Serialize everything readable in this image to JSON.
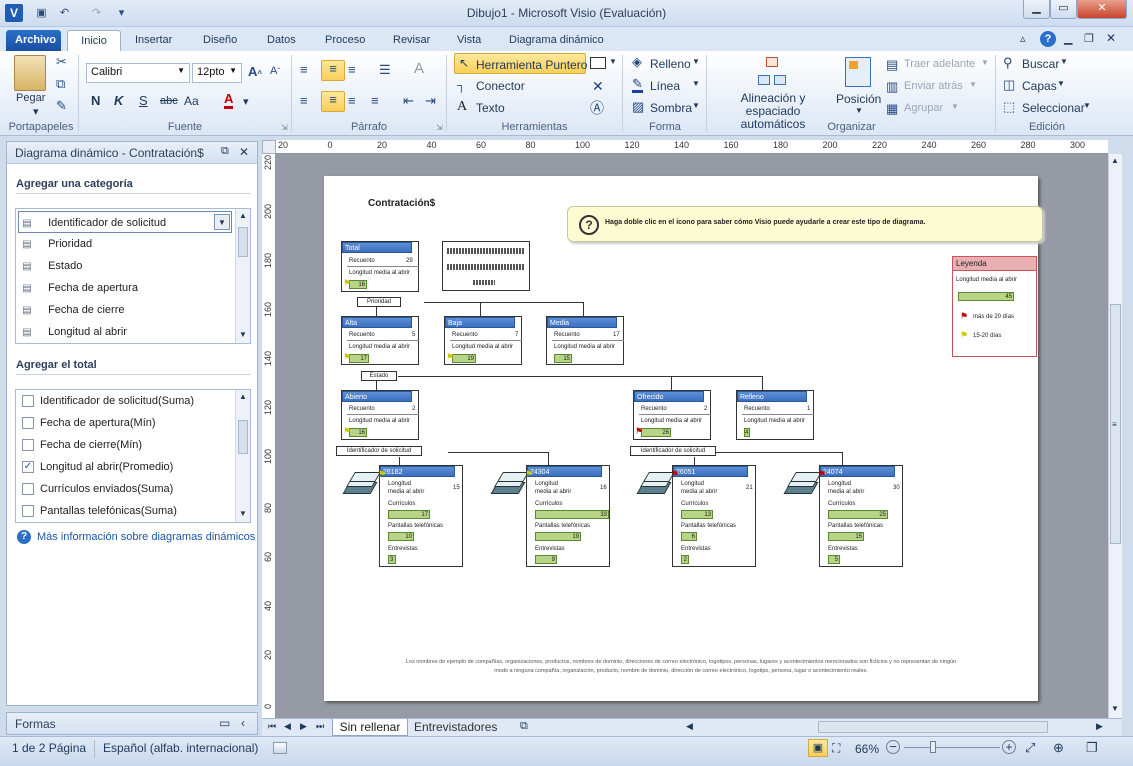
{
  "window": {
    "title": "Dibujo1 - Microsoft Visio (Evaluación)"
  },
  "tabs": [
    "Archivo",
    "Inicio",
    "Insertar",
    "Diseño",
    "Datos",
    "Proceso",
    "Revisar",
    "Vista",
    "Diagrama dinámico"
  ],
  "ribbon": {
    "paste": "Pegar",
    "font_name": "Calibri",
    "font_size": "12pto",
    "format_buttons": [
      "N",
      "K",
      "S",
      "abc",
      "Aa"
    ],
    "tools": {
      "pointer": "Herramienta Puntero",
      "connector": "Conector",
      "text": "Texto"
    },
    "shape": {
      "fill": "Relleno",
      "line": "Línea",
      "shadow": "Sombra"
    },
    "arrange": {
      "auto": "Alineación y espaciado automáticos",
      "position": "Posición",
      "front": "Traer adelante",
      "back": "Enviar atrás",
      "group": "Agrupar"
    },
    "edit": {
      "find": "Buscar",
      "layers": "Capas",
      "select": "Seleccionar"
    },
    "groups": [
      "Portapapeles",
      "Fuente",
      "Párrafo",
      "Herramientas",
      "Forma",
      "Organizar",
      "Edición"
    ]
  },
  "pane": {
    "title": "Diagrama dinámico - Contratación$",
    "add_category": "Agregar una categoría",
    "categories": [
      "Identificador de solicitud",
      "Prioridad",
      "Estado",
      "Fecha de apertura",
      "Fecha de cierre",
      "Longitud al abrir"
    ],
    "add_total": "Agregar el total",
    "totals": [
      {
        "label": "Identificador de solicitud(Suma)",
        "checked": false
      },
      {
        "label": "Fecha de apertura(Mín)",
        "checked": false
      },
      {
        "label": "Fecha de cierre(Mín)",
        "checked": false
      },
      {
        "label": "Longitud al abrir(Promedio)",
        "checked": true
      },
      {
        "label": "Currículos enviados(Suma)",
        "checked": false
      },
      {
        "label": "Pantallas telefónicas(Suma)",
        "checked": false
      }
    ],
    "more_info": "Más información sobre diagramas dinámicos",
    "shapes": "Formas"
  },
  "ruler_h": [
    "20",
    "0",
    "20",
    "40",
    "60",
    "80",
    "100",
    "120",
    "140",
    "160",
    "180",
    "200",
    "220",
    "240",
    "260",
    "280",
    "300"
  ],
  "ruler_v": [
    "220",
    "200",
    "180",
    "160",
    "140",
    "120",
    "100",
    "80",
    "60",
    "40",
    "20",
    "0"
  ],
  "diagram": {
    "title": "Contratación$",
    "hint": "Haga doble clic en el icono para saber cómo Visio puede ayudarle a crear este tipo de diagrama.",
    "legend": {
      "title": "Leyenda",
      "metric": "Longitud media al abrir",
      "bar_value": "45",
      "red_flag": "más de 20 días",
      "yellow_flag": "15-20 días"
    },
    "total": {
      "title": "Total",
      "count_label": "Recuento",
      "count": "29",
      "avg_label": "Longitud media al abrir",
      "avg": "16"
    },
    "cat_priority": "Prioridad",
    "cat_status": "Estado",
    "cat_id": "Identificador de solicitud",
    "priority_nodes": [
      {
        "title": "Alta",
        "count": "5",
        "avg": "17"
      },
      {
        "title": "Baja",
        "count": "7",
        "avg": "19"
      },
      {
        "title": "Media",
        "count": "17",
        "avg": "15"
      }
    ],
    "status_nodes": [
      {
        "title": "Abierto",
        "count": "2",
        "avg": "16"
      },
      {
        "title": "Ofrecido",
        "count": "2",
        "avg": "26"
      },
      {
        "title": "Relleno",
        "count": "1",
        "avg": "4"
      }
    ],
    "labels": {
      "count": "Recuento",
      "avg": "Longitud media al abrir",
      "avg_short1": "Longitud",
      "avg_short2": "media al abrir",
      "cv": "Currículos",
      "phone": "Pantallas telefónicas",
      "interviews": "Entrevistas"
    },
    "id_nodes": [
      {
        "title": "26182",
        "avg": "15",
        "cv": "17",
        "phone": "10",
        "interviews": "3"
      },
      {
        "title": "24304",
        "avg": "16",
        "cv": "33",
        "phone": "19",
        "interviews": "9"
      },
      {
        "title": "26051",
        "avg": "21",
        "cv": "13",
        "phone": "6",
        "interviews": "2"
      },
      {
        "title": "24074",
        "avg": "30",
        "cv": "25",
        "phone": "15",
        "interviews": "5"
      }
    ],
    "disclaimer1": "Los nombres de ejemplo de compañías, organizaciones, productos, nombres de dominio, direcciones de correo electrónico, logotipos, personas, lugares y acontecimientos mencionados son ficticios y no representan de ningún",
    "disclaimer2": "modo a ninguna compañía, organización, producto, nombre de dominio, dirección de correo electrónico, logotipo, persona, lugar o acontecimiento reales."
  },
  "page_tabs": [
    "Sin rellenar",
    "Entrevistadores"
  ],
  "status": {
    "page": "1 de 2 Página",
    "language": "Español (alfab. internacional)",
    "zoom": "66%"
  },
  "colors": {
    "accent": "#2a6fc8",
    "node_header": "#4a7fcf",
    "bar": "#b8d486",
    "legend": "#c9545a"
  }
}
